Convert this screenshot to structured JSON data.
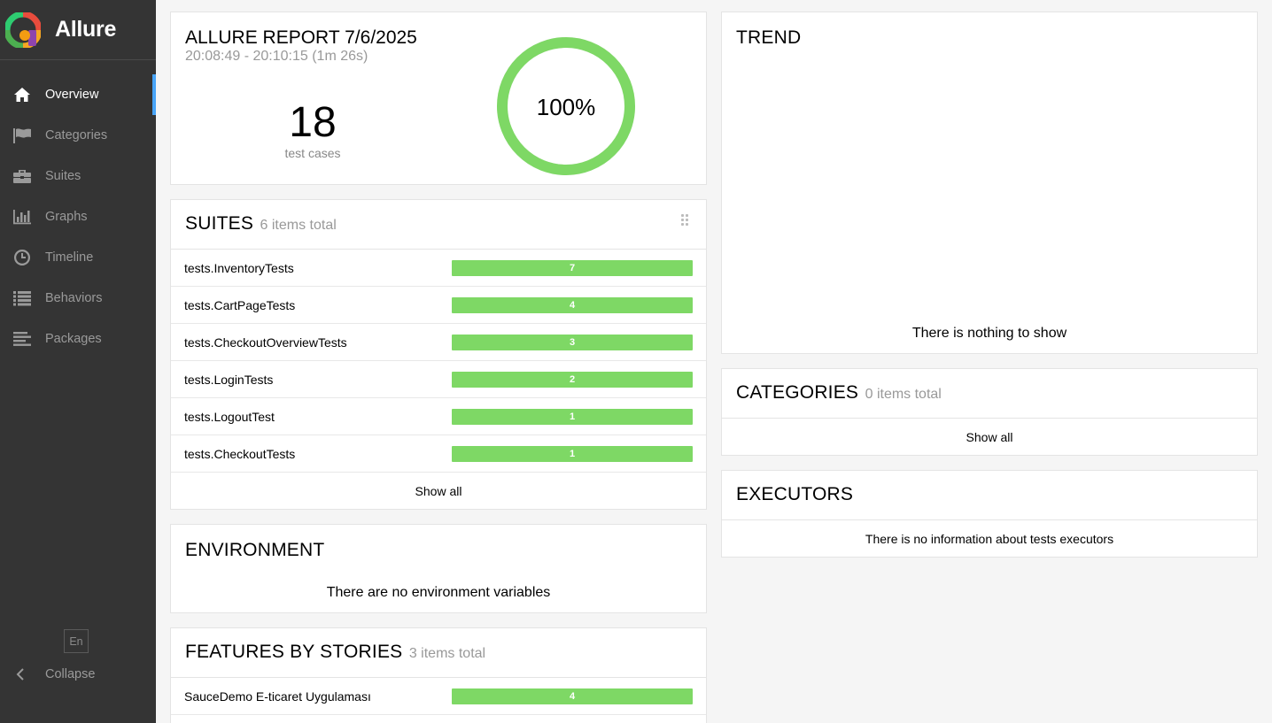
{
  "app": {
    "name": "Allure"
  },
  "sidebar": {
    "items": [
      {
        "label": "Overview",
        "icon": "home-icon",
        "active": true
      },
      {
        "label": "Categories",
        "icon": "flag-icon"
      },
      {
        "label": "Suites",
        "icon": "briefcase-icon"
      },
      {
        "label": "Graphs",
        "icon": "bar-chart-icon"
      },
      {
        "label": "Timeline",
        "icon": "clock-icon"
      },
      {
        "label": "Behaviors",
        "icon": "list-icon"
      },
      {
        "label": "Packages",
        "icon": "align-left-icon"
      }
    ],
    "language": "En",
    "collapse_label": "Collapse"
  },
  "summary": {
    "title": "ALLURE REPORT 7/6/2025",
    "time_range": "20:08:49 - 20:10:15 (1m 26s)",
    "test_count": "18",
    "test_count_label": "test cases",
    "pass_rate_label": "100%",
    "pass_rate": 1.0,
    "ring_color": "#7ed865"
  },
  "suites": {
    "title": "SUITES",
    "count_label": "6 items total",
    "rows": [
      {
        "name": "tests.InventoryTests",
        "count": "7"
      },
      {
        "name": "tests.CartPageTests",
        "count": "4"
      },
      {
        "name": "tests.CheckoutOverviewTests",
        "count": "3"
      },
      {
        "name": "tests.LoginTests",
        "count": "2"
      },
      {
        "name": "tests.LogoutTest",
        "count": "1"
      },
      {
        "name": "tests.CheckoutTests",
        "count": "1"
      }
    ],
    "show_all": "Show all"
  },
  "environment": {
    "title": "ENVIRONMENT",
    "empty": "There are no environment variables"
  },
  "features": {
    "title": "FEATURES BY STORIES",
    "count_label": "3 items total",
    "rows": [
      {
        "name": "SauceDemo E-ticaret Uygulaması",
        "count": "4"
      }
    ]
  },
  "trend": {
    "title": "TREND",
    "empty": "There is nothing to show"
  },
  "categories": {
    "title": "CATEGORIES",
    "count_label": "0 items total",
    "show_all": "Show all"
  },
  "executors": {
    "title": "EXECUTORS",
    "empty": "There is no information about tests executors"
  },
  "colors": {
    "passed": "#7ed865",
    "accent": "#49a5f8",
    "sidebar": "#343434"
  }
}
